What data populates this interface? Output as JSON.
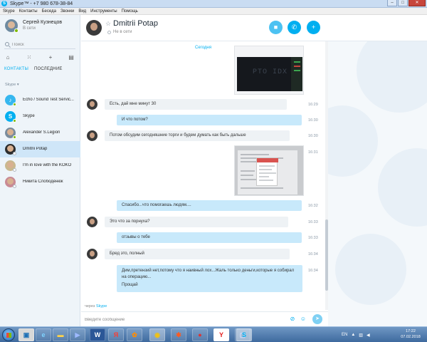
{
  "window": {
    "title": "Skype™ - +7 980 678-38-84"
  },
  "menu": [
    "Skype",
    "Контакты",
    "Беседа",
    "Звонки",
    "Вид",
    "Инструменты",
    "Помощь"
  ],
  "profile": {
    "name": "Сергей Кузнецов",
    "status": "В сети"
  },
  "search": {
    "placeholder": "Поиск"
  },
  "tabs": {
    "contacts": "КОНТАКТЫ",
    "recent": "ПОСЛЕДНИЕ"
  },
  "group_label": "Skype ▾",
  "contacts": [
    {
      "name": "Echo / Sound Test Servic..."
    },
    {
      "name": "Skype"
    },
    {
      "name": "Alexander S.Legion"
    },
    {
      "name": "Dmitrii Potap"
    },
    {
      "name": "I'm in love with the KOKO"
    },
    {
      "name": "Никита Слободенюк"
    }
  ],
  "chat": {
    "name": "Dmitrii Potap",
    "status": "Не в сети"
  },
  "messages": {
    "date_label": "Сегодня",
    "items": [
      {
        "text": "Есть, дай мне минут 30",
        "time": "16:29"
      },
      {
        "text": "И что потом?",
        "time": "16:30"
      },
      {
        "text": "Потом обсудим сегодняшние торги и будем думать как быть дальше",
        "time": "16:30"
      },
      {
        "time": "16:31"
      },
      {
        "text": "Спасибо...что помогаешь людям....",
        "time": "16:32"
      },
      {
        "text": "Это что за порнуха?",
        "time": "16:33"
      },
      {
        "text": "отзывы о тебе",
        "time": "16:33"
      },
      {
        "text": "Бред это, полный",
        "time": "16:34"
      },
      {
        "text": "Дим,претензий нет,потому что я наивный лох...Жаль только деньги,которые я собирал на операцию...",
        "text2": "Прощай",
        "time": "16:34"
      }
    ],
    "image_text": "PTO IDX"
  },
  "compose": {
    "placeholder": "Введите сообщение",
    "via_prefix": "через",
    "via_link": "Skype"
  },
  "taskbar": {
    "tray_lang": "EN",
    "time": "17:22",
    "date": "07.02.2018"
  },
  "colors": {
    "accent": "#00aff0",
    "bubble_out": "#c8e9fb",
    "bubble_in": "#eef2f5",
    "online": "#7fba00"
  }
}
